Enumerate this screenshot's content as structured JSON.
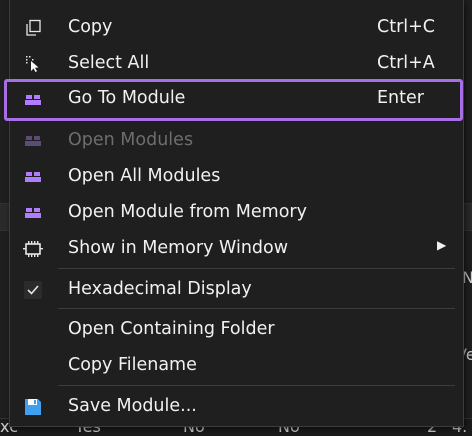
{
  "background": {
    "fragments": [
      "Ve",
      "N",
      "4.",
      "2",
      "Yes",
      "No",
      "No",
      "xc"
    ]
  },
  "menu": {
    "items": [
      {
        "label": "Copy",
        "shortcut": "Ctrl+C",
        "icon": "copy-icon"
      },
      {
        "label": "Select All",
        "shortcut": "Ctrl+A",
        "icon": "select-all-icon"
      },
      {
        "label": "Go To Module",
        "shortcut": "Enter",
        "icon": "module-icon"
      },
      {
        "label": "Open Modules",
        "icon": "module-icon",
        "disabled": true
      },
      {
        "label": "Open All Modules",
        "icon": "module-icon"
      },
      {
        "label": "Open Module from Memory",
        "icon": "module-icon"
      },
      {
        "label": "Show in Memory Window",
        "icon": "memory-chip-icon",
        "submenu": "▶"
      },
      {
        "label": "Hexadecimal Display",
        "icon": "checkmark-icon"
      },
      {
        "label": "Open Containing Folder"
      },
      {
        "label": "Copy Filename"
      },
      {
        "label": "Save Module...",
        "icon": "save-icon"
      }
    ]
  },
  "colors": {
    "highlight": "#a86ee6",
    "accent": "#b07dff",
    "save": "#3fa0f0"
  }
}
